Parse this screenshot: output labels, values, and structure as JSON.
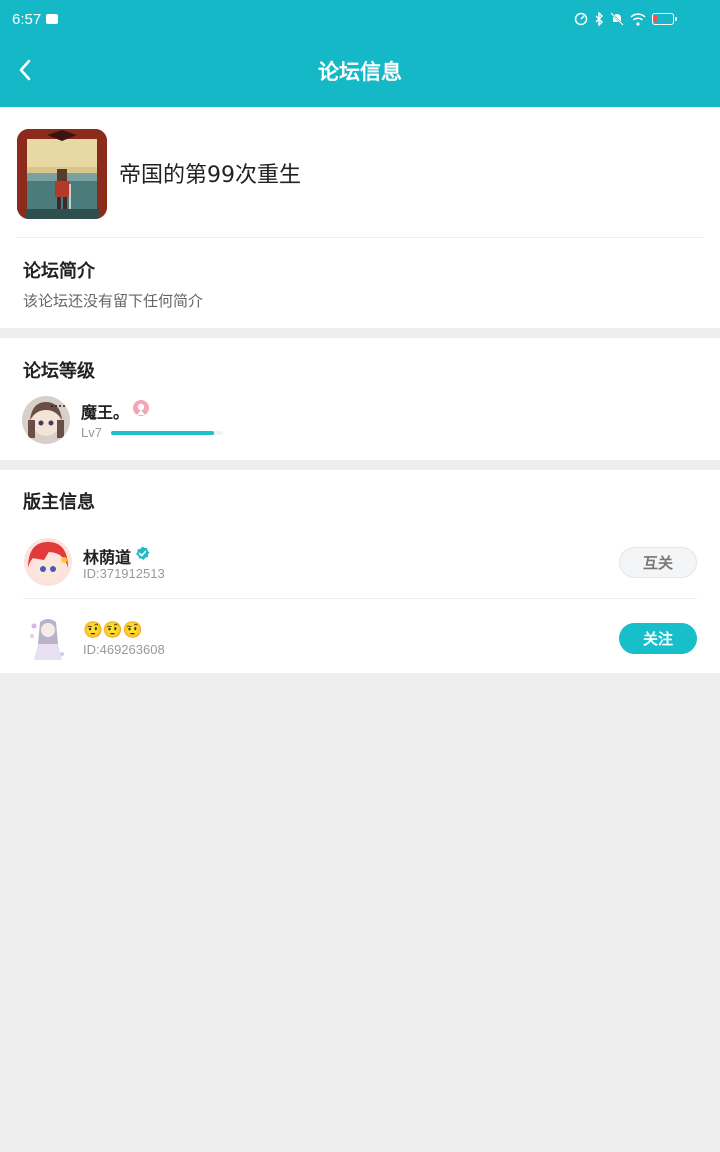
{
  "status_bar": {
    "time": "6:57"
  },
  "header": {
    "title": "论坛信息"
  },
  "forum": {
    "name": "帝国的第99次重生",
    "intro_title": "论坛简介",
    "intro_text": "该论坛还没有留下任何简介"
  },
  "level_section": {
    "title": "论坛等级",
    "user_name": "魔王。",
    "level": "Lv7",
    "progress": 0.92
  },
  "moderators": {
    "title": "版主信息",
    "items": [
      {
        "name": "林荫道",
        "id": "ID:371912513",
        "button": "互关",
        "verified": true
      },
      {
        "name": "🤨🤨🤨",
        "id": "ID:469263608",
        "button": "关注",
        "verified": false
      }
    ]
  },
  "colors": {
    "accent": "#15b8c6",
    "follow_button": "#17bfcb"
  }
}
